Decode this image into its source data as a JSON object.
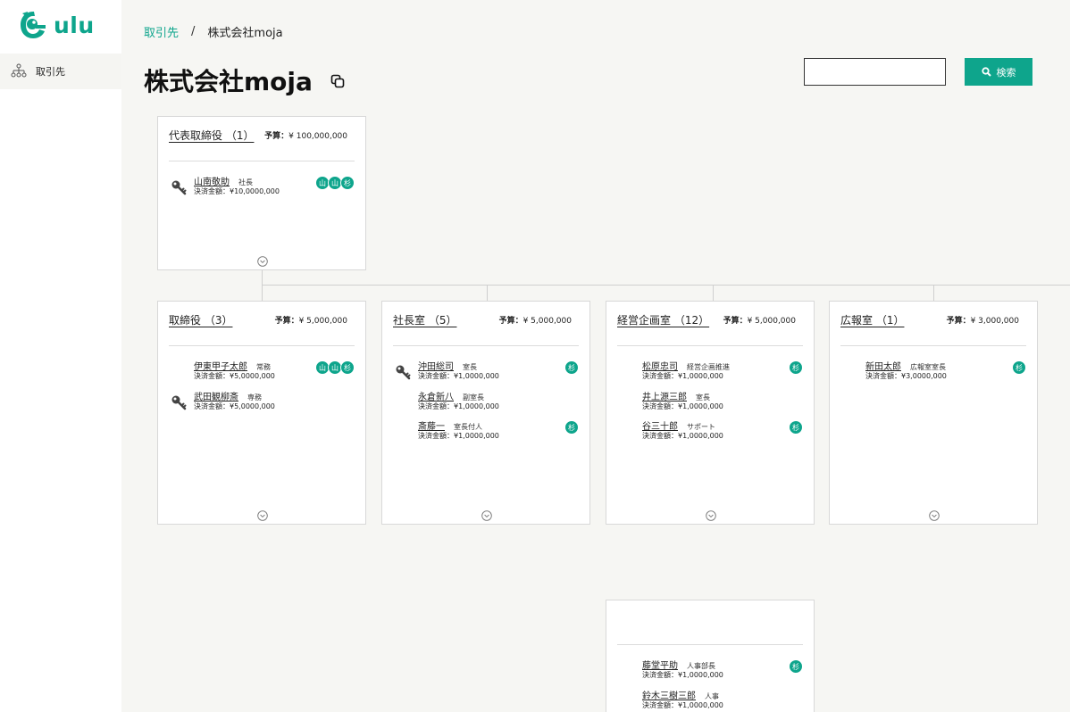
{
  "app": {
    "logo_text": "ulu",
    "brand_color": "#0ea58c"
  },
  "sidebar": {
    "items": [
      {
        "label": "取引先",
        "icon": "org-chart-icon"
      }
    ]
  },
  "breadcrumb": {
    "root": "取引先",
    "separator": "/",
    "current": "株式会社moja"
  },
  "page": {
    "title": "株式会社moja"
  },
  "search": {
    "value": "",
    "placeholder": "",
    "button_label": "検索"
  },
  "budget_label": "予算：",
  "amount_label": "決済金額：",
  "cards": {
    "top": {
      "name": "代表取締役 （1）",
      "budget": "¥ 100,000,000",
      "members": [
        {
          "name": "山南敬助",
          "role": "社長",
          "amount": "¥10,0000,000",
          "key": true,
          "badges": [
            "山",
            "山",
            "杉"
          ]
        }
      ]
    },
    "c1": {
      "name": "取締役 （3）",
      "budget": "¥ 5,000,000",
      "members": [
        {
          "name": "伊東甲子太郎",
          "role": "常務",
          "amount": "¥5,0000,000",
          "key": false,
          "badges": [
            "山",
            "山",
            "杉"
          ]
        },
        {
          "name": "武田観柳斎",
          "role": "専務",
          "amount": "¥5,0000,000",
          "key": true,
          "badges": []
        }
      ]
    },
    "c2": {
      "name": "社長室 （5）",
      "budget": "¥ 5,000,000",
      "members": [
        {
          "name": "沖田総司",
          "role": "室長",
          "amount": "¥1,0000,000",
          "key": true,
          "badges": [
            "杉"
          ]
        },
        {
          "name": "永倉新八",
          "role": "副室長",
          "amount": "¥1,0000,000",
          "key": false,
          "badges": []
        },
        {
          "name": "斎藤一",
          "role": "室長付人",
          "amount": "¥1,0000,000",
          "key": false,
          "badges": [
            "杉"
          ]
        }
      ]
    },
    "c3": {
      "name": "経営企画室 （12）",
      "budget": "¥ 5,000,000",
      "members": [
        {
          "name": "松原忠司",
          "role": "経営企画推進",
          "amount": "¥1,0000,000",
          "key": false,
          "badges": [
            "杉"
          ]
        },
        {
          "name": "井上源三郎",
          "role": "室長",
          "amount": "¥1,0000,000",
          "key": false,
          "badges": []
        },
        {
          "name": "谷三十郎",
          "role": "サポート",
          "amount": "¥1,0000,000",
          "key": false,
          "badges": [
            "杉"
          ]
        }
      ]
    },
    "c4": {
      "name": "広報室 （1）",
      "budget": "¥ 3,000,000",
      "members": [
        {
          "name": "新田太郎",
          "role": "広報室室長",
          "amount": "¥3,0000,000",
          "key": false,
          "badges": [
            "杉"
          ]
        }
      ]
    },
    "c5": {
      "name": "",
      "budget": "",
      "members": [
        {
          "name": "藤堂平助",
          "role": "人事部長",
          "amount": "¥1,0000,000",
          "key": false,
          "badges": [
            "杉"
          ]
        },
        {
          "name": "鈴木三樹三郎",
          "role": "人事",
          "amount": "¥1,0000,000",
          "key": false,
          "badges": []
        }
      ]
    }
  }
}
